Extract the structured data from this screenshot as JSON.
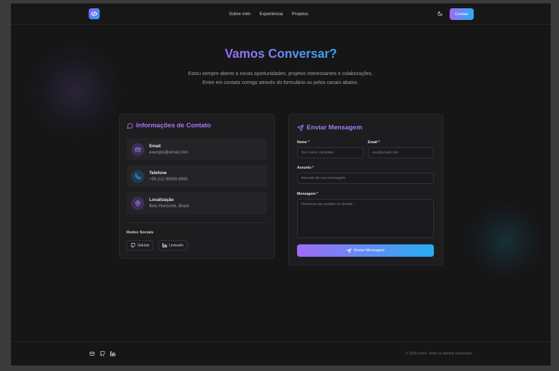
{
  "header": {
    "nav": [
      "Sobre mim",
      "Experiência",
      "Projetos"
    ],
    "contact_button": "Contato"
  },
  "hero": {
    "title": "Vamos Conversar?",
    "description": "Estou sempre aberto a novas oportunidades, projetos interessantes e colaborações. Entre em contato comigo através do formulário ou pelos canais abaixo."
  },
  "contact_info": {
    "title": "Informações de Contato",
    "items": [
      {
        "label": "Email",
        "value": "exemplo@email.com",
        "icon": "mail-icon"
      },
      {
        "label": "Telefone",
        "value": "+55 (11) 99999-9999",
        "icon": "phone-icon"
      },
      {
        "label": "Localização",
        "value": "Belo Horizonte, Brasil",
        "icon": "map-pin-icon"
      }
    ],
    "social_title": "Redes Sociais",
    "social": [
      {
        "label": "GitHub",
        "icon": "github-icon"
      },
      {
        "label": "LinkedIn",
        "icon": "linkedin-icon"
      }
    ]
  },
  "form": {
    "title": "Enviar Mensagem",
    "name_label": "Nome *",
    "name_placeholder": "Seu nome completo",
    "email_label": "Email *",
    "email_placeholder": "seu@email.com",
    "subject_label": "Assunto *",
    "subject_placeholder": "Assunto da sua mensagem",
    "message_label": "Mensagem *",
    "message_placeholder": "Descreva seu projeto ou dúvida...",
    "submit_label": "Enviar Mensagem"
  },
  "footer": {
    "copyright": "© 2025 nome. Todos os direitos reservados."
  },
  "colors": {
    "accent_purple": "#a77af7",
    "accent_blue": "#27aef1",
    "background": "#161617"
  }
}
